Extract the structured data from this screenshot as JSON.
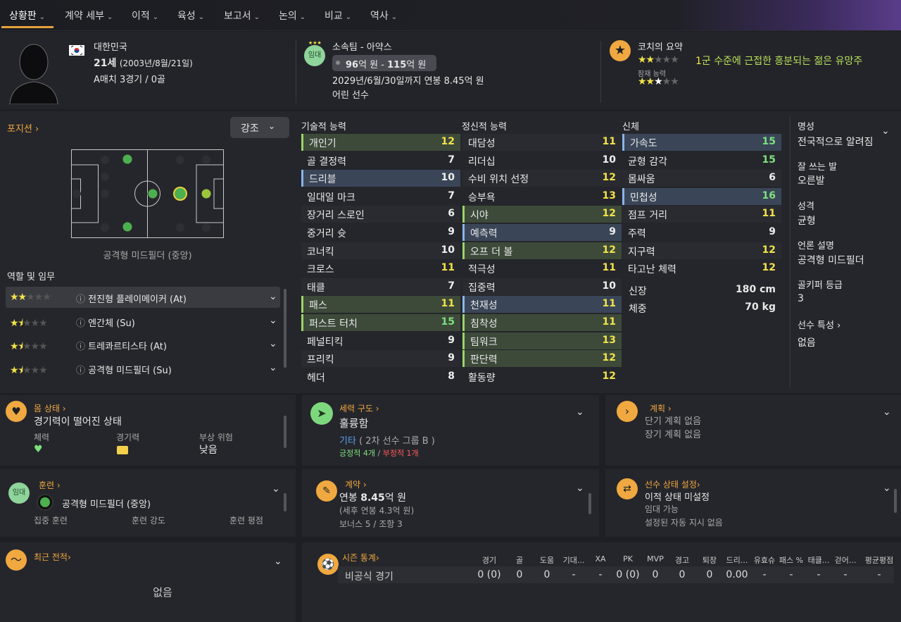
{
  "nav": {
    "items": [
      "상황판",
      "계약 세부",
      "이적",
      "육성",
      "보고서",
      "논의",
      "비교",
      "역사"
    ]
  },
  "header": {
    "nation": "대한민국",
    "age_main": "21세",
    "birthdate": "(2003년/8월/21일)",
    "caps": "A매치 3경기 / 0골",
    "loan_badge": "임대",
    "club": "소속팀 - 아약스",
    "value_low": "96",
    "value_low_unit": "억 원 - ",
    "value_high": "115",
    "value_high_unit": "억 원",
    "contract": "2029년/6월/30일까지 연봉 8.45억 원",
    "player_type": "어린 선수",
    "coach_title": "코치의 요약",
    "coach_summary_num": "1",
    "coach_summary": "군 수준에 근접한 흥분되는 젊은 유망주",
    "potential_label": "잠재 능력",
    "current_stars": 2,
    "potential_stars": 3
  },
  "positions": {
    "title": "포지션",
    "highlight_button": "강조",
    "position_name": "공격형 미드필더 (중앙)",
    "roles_title": "역할 및 임무",
    "roles": [
      {
        "name": "전진형 플레이메이커 (At)",
        "stars": 2
      },
      {
        "name": "엔간체 (Su)",
        "stars": 1.5
      },
      {
        "name": "트레콰르티스타 (At)",
        "stars": 1.5
      },
      {
        "name": "공격형 미드필더 (Su)",
        "stars": 1.5
      }
    ]
  },
  "attributes": {
    "technical_title": "기술적 능력",
    "mental_title": "정신적 능력",
    "physical_title": "신체",
    "technical": [
      {
        "name": "개인기",
        "value": "12",
        "hl": "green"
      },
      {
        "name": "골 결정력",
        "value": "7",
        "hl": ""
      },
      {
        "name": "드리블",
        "value": "10",
        "hl": "blue"
      },
      {
        "name": "일대일 마크",
        "value": "7",
        "hl": ""
      },
      {
        "name": "장거리 스로인",
        "value": "6",
        "hl": ""
      },
      {
        "name": "중거리 슛",
        "value": "9",
        "hl": ""
      },
      {
        "name": "코너킥",
        "value": "10",
        "hl": ""
      },
      {
        "name": "크로스",
        "value": "11",
        "hl": ""
      },
      {
        "name": "태클",
        "value": "7",
        "hl": ""
      },
      {
        "name": "패스",
        "value": "11",
        "hl": "green"
      },
      {
        "name": "퍼스트 터치",
        "value": "15",
        "hl": "green"
      },
      {
        "name": "페널티킥",
        "value": "9",
        "hl": ""
      },
      {
        "name": "프리킥",
        "value": "9",
        "hl": ""
      },
      {
        "name": "헤더",
        "value": "8",
        "hl": ""
      }
    ],
    "mental": [
      {
        "name": "대담성",
        "value": "11",
        "hl": ""
      },
      {
        "name": "리더십",
        "value": "10",
        "hl": ""
      },
      {
        "name": "수비 위치 선정",
        "value": "12",
        "hl": ""
      },
      {
        "name": "승부욕",
        "value": "13",
        "hl": ""
      },
      {
        "name": "시야",
        "value": "12",
        "hl": "green"
      },
      {
        "name": "예측력",
        "value": "9",
        "hl": "blue"
      },
      {
        "name": "오프 더 볼",
        "value": "12",
        "hl": "green"
      },
      {
        "name": "적극성",
        "value": "11",
        "hl": ""
      },
      {
        "name": "집중력",
        "value": "10",
        "hl": ""
      },
      {
        "name": "천재성",
        "value": "11",
        "hl": "blue"
      },
      {
        "name": "침착성",
        "value": "11",
        "hl": "green"
      },
      {
        "name": "팀워크",
        "value": "13",
        "hl": "green"
      },
      {
        "name": "판단력",
        "value": "12",
        "hl": "green"
      },
      {
        "name": "활동량",
        "value": "12",
        "hl": ""
      }
    ],
    "physical": [
      {
        "name": "가속도",
        "value": "15",
        "hl": "blue"
      },
      {
        "name": "균형 감각",
        "value": "15",
        "hl": ""
      },
      {
        "name": "몸싸움",
        "value": "6",
        "hl": ""
      },
      {
        "name": "민첩성",
        "value": "16",
        "hl": "blue"
      },
      {
        "name": "점프 거리",
        "value": "11",
        "hl": ""
      },
      {
        "name": "주력",
        "value": "9",
        "hl": ""
      },
      {
        "name": "지구력",
        "value": "12",
        "hl": ""
      },
      {
        "name": "타고난 체력",
        "value": "12",
        "hl": ""
      }
    ],
    "height_label": "신장",
    "height": "180 cm",
    "weight_label": "체중",
    "weight": "70 kg"
  },
  "side": {
    "reputation_label": "명성",
    "reputation": "전국적으로 알려짐",
    "foot_label": "잘 쓰는 발",
    "foot": "오른발",
    "personality_label": "성격",
    "personality": "균형",
    "media_label": "언론 설명",
    "media": "공격형 미드필더",
    "gk_label": "골키퍼 등급",
    "gk": "3",
    "traits_label": "선수 특성",
    "traits": "없음"
  },
  "condition": {
    "title": "몸 상태",
    "status": "경기력이 떨어진 상태",
    "c1": "체력",
    "c2": "경기력",
    "c3": "부상 위험",
    "c3_val": "낮음"
  },
  "dynamics": {
    "title": "세력 구도",
    "status": "훌륭함",
    "group_a": "기타",
    "group_b": "( 2차 선수 그룹 B )",
    "positive": "긍정적 4개",
    "divider": "/",
    "negative": "부정적 1개"
  },
  "plans": {
    "title": "계획",
    "short": "단기 계획 없음",
    "long": "장기 계획 없음"
  },
  "training": {
    "badge": "임대",
    "title": "훈련",
    "position": "공격형 미드필더 (중앙)",
    "c1": "집중 훈련",
    "c2": "훈련 강도",
    "c3": "훈련 평점"
  },
  "contract": {
    "title": "계약",
    "wage_prefix": "연봉 ",
    "wage": "8.45",
    "wage_suffix": "억 원",
    "after_tax": "(세후 연봉 4.3억 원)",
    "bonus": "보너스 5 / 조항 3"
  },
  "status": {
    "title": "선수 상태 설정",
    "transfer": "이적 상태 미설정",
    "loan": "임대 가능",
    "auto": "설정된 자동 지시 없음"
  },
  "form": {
    "title": "최근 전적",
    "value": "없음"
  },
  "season": {
    "title": "시즌 통계",
    "headers": [
      "경기",
      "골",
      "도움",
      "기대...",
      "XA",
      "PK",
      "MVP",
      "경고",
      "퇴장",
      "드리...",
      "유효슈",
      "패스 %",
      "태클...",
      "걷어...",
      "평균평점"
    ],
    "row_label": "비공식 경기",
    "row": [
      "0 (0)",
      "0",
      "0",
      "-",
      "-",
      "0 (0)",
      "0",
      "0",
      "0",
      "0.00",
      "-",
      "-",
      "-",
      "-",
      "-"
    ]
  }
}
